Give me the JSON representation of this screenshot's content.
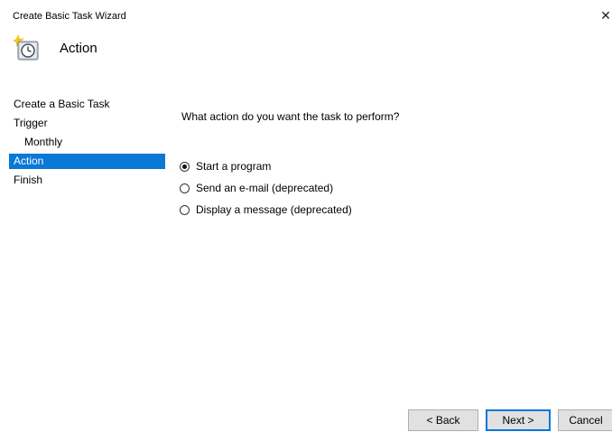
{
  "window": {
    "title": "Create Basic Task Wizard",
    "close_glyph": "✕"
  },
  "header": {
    "title": "Action",
    "icon": "task-scheduler-clock-icon"
  },
  "steps": [
    {
      "label": "Create a Basic Task",
      "active": false,
      "indent": false
    },
    {
      "label": "Trigger",
      "active": false,
      "indent": false
    },
    {
      "label": "Monthly",
      "active": false,
      "indent": true
    },
    {
      "label": "Action",
      "active": true,
      "indent": false
    },
    {
      "label": "Finish",
      "active": false,
      "indent": false
    }
  ],
  "main": {
    "question": "What action do you want the task to perform?",
    "options": [
      {
        "label": "Start a program",
        "checked": true
      },
      {
        "label": "Send an e-mail (deprecated)",
        "checked": false
      },
      {
        "label": "Display a message (deprecated)",
        "checked": false
      }
    ]
  },
  "buttons": {
    "back": "< Back",
    "next": "Next >",
    "cancel": "Cancel"
  },
  "colors": {
    "selection": "#0a78d7",
    "default_button_border": "#0078d7"
  }
}
